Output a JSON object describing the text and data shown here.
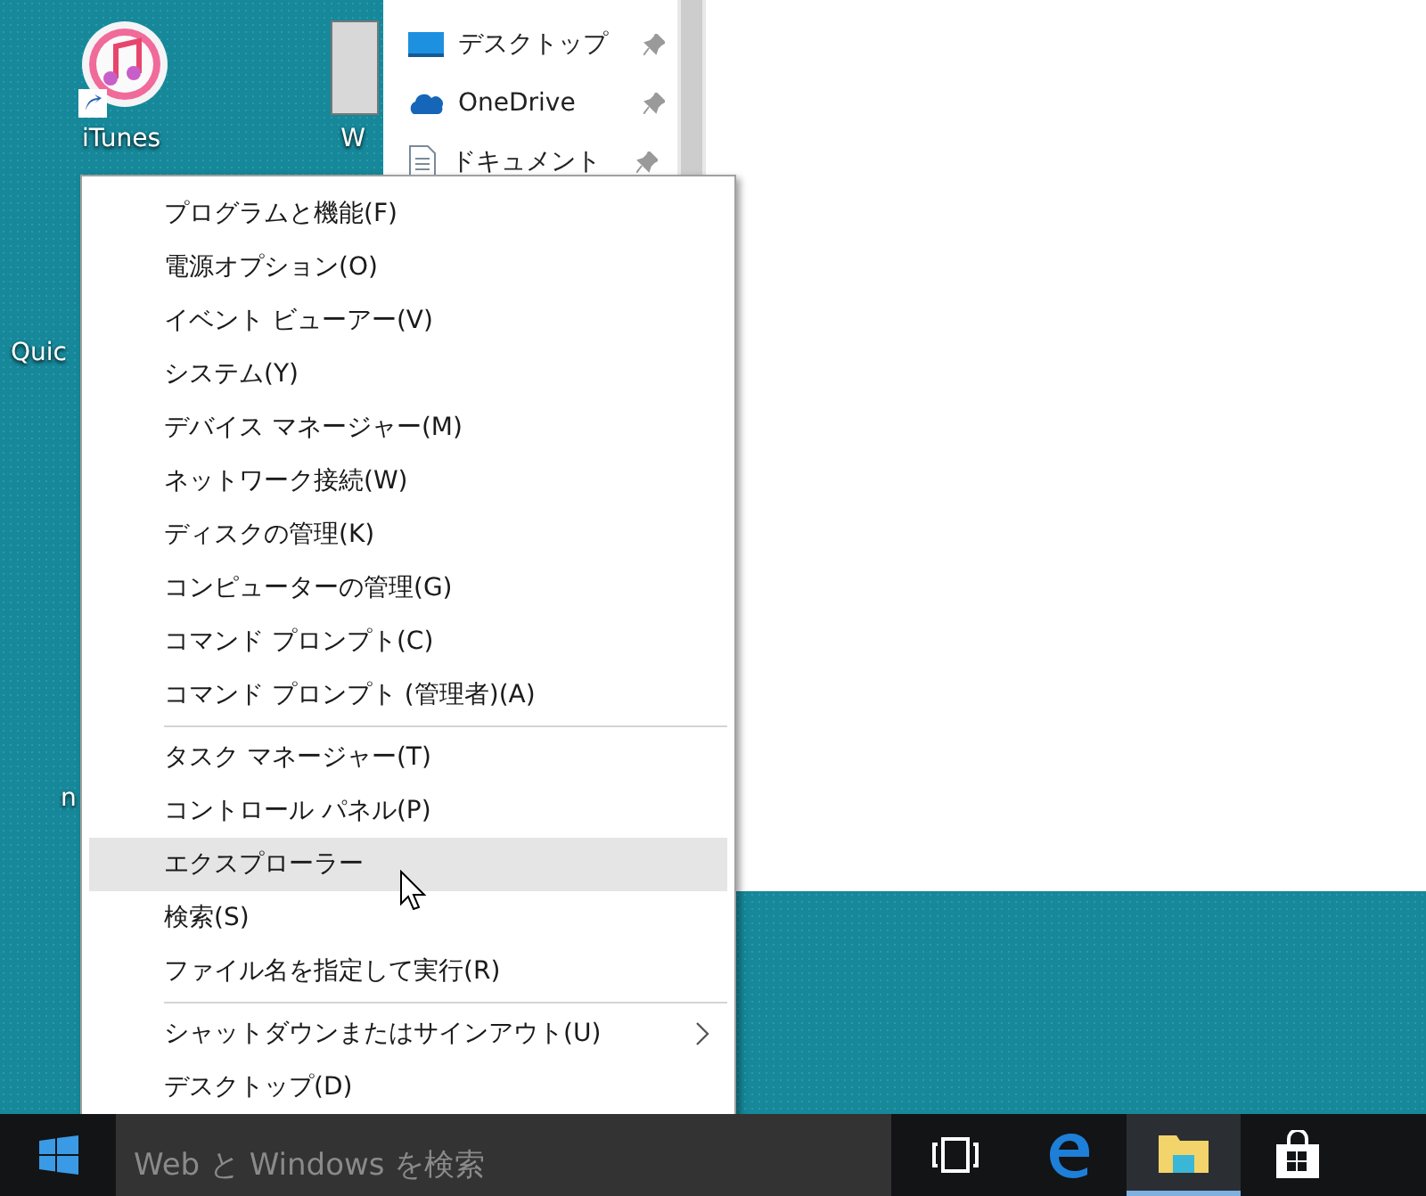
{
  "desktop_icons": [
    {
      "kind": "itunes",
      "label": "iTunes"
    },
    {
      "kind": "app",
      "label": "W"
    },
    {
      "kind": "label",
      "label": "Quic"
    },
    {
      "kind": "label",
      "label": "n"
    }
  ],
  "explorer": {
    "quick_access": [
      {
        "kind": "desktop",
        "label": "デスクトップ",
        "pinned": true
      },
      {
        "kind": "cloud",
        "label": "OneDrive",
        "pinned": true
      },
      {
        "kind": "document",
        "label": "ドキュメント",
        "pinned": true
      }
    ]
  },
  "context_menu": {
    "groups": [
      [
        {
          "label": "プログラムと機能(F)",
          "selected": false,
          "submenu": false
        },
        {
          "label": "電源オプション(O)",
          "selected": false,
          "submenu": false
        },
        {
          "label": "イベント ビューアー(V)",
          "selected": false,
          "submenu": false
        },
        {
          "label": "システム(Y)",
          "selected": false,
          "submenu": false
        },
        {
          "label": "デバイス マネージャー(M)",
          "selected": false,
          "submenu": false
        },
        {
          "label": "ネットワーク接続(W)",
          "selected": false,
          "submenu": false
        },
        {
          "label": "ディスクの管理(K)",
          "selected": false,
          "submenu": false
        },
        {
          "label": "コンピューターの管理(G)",
          "selected": false,
          "submenu": false
        },
        {
          "label": "コマンド プロンプト(C)",
          "selected": false,
          "submenu": false
        },
        {
          "label": "コマンド プロンプト (管理者)(A)",
          "selected": false,
          "submenu": false
        }
      ],
      [
        {
          "label": "タスク マネージャー(T)",
          "selected": false,
          "submenu": false
        },
        {
          "label": "コントロール パネル(P)",
          "selected": false,
          "submenu": false
        },
        {
          "label": "エクスプローラー",
          "selected": true,
          "submenu": false
        },
        {
          "label": "検索(S)",
          "selected": false,
          "submenu": false
        },
        {
          "label": "ファイル名を指定して実行(R)",
          "selected": false,
          "submenu": false
        }
      ],
      [
        {
          "label": "シャットダウンまたはサインアウト(U)",
          "selected": false,
          "submenu": true
        },
        {
          "label": "デスクトップ(D)",
          "selected": false,
          "submenu": false
        }
      ]
    ]
  },
  "taskbar": {
    "search_placeholder": "Web と Windows を検索",
    "apps": [
      {
        "kind": "task-view",
        "active": false
      },
      {
        "kind": "edge",
        "active": false
      },
      {
        "kind": "explorer",
        "active": true
      },
      {
        "kind": "store",
        "active": false
      }
    ]
  }
}
